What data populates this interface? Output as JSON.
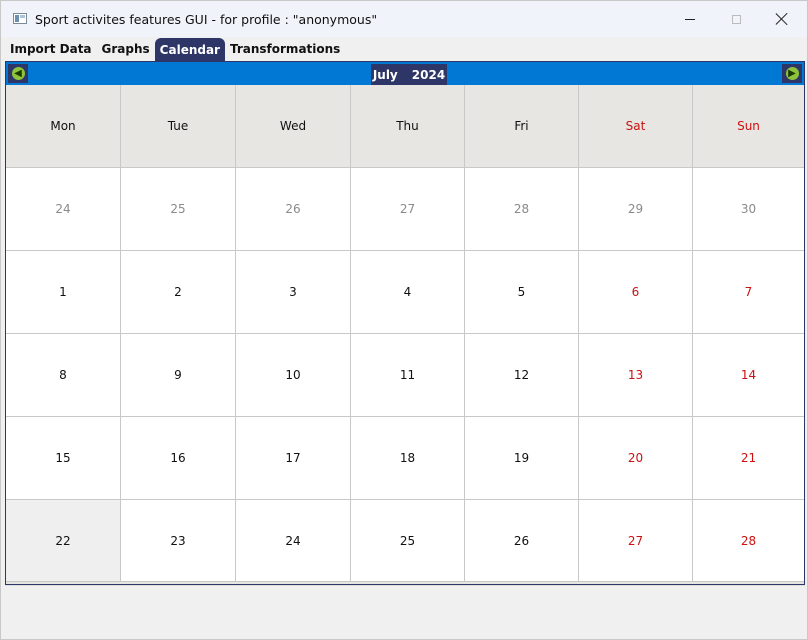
{
  "window": {
    "title": "Sport activites features GUI - for profile : \"anonymous\""
  },
  "tabs": [
    {
      "label": "Import Data"
    },
    {
      "label": "Graphs"
    },
    {
      "label": "Calendar"
    },
    {
      "label": "Transformations"
    }
  ],
  "calendar": {
    "month": "July",
    "year": "2024",
    "weekdays": [
      "Mon",
      "Tue",
      "Wed",
      "Thu",
      "Fri",
      "Sat",
      "Sun"
    ],
    "weeks": [
      [
        "24",
        "25",
        "26",
        "27",
        "28",
        "29",
        "30"
      ],
      [
        "1",
        "2",
        "3",
        "4",
        "5",
        "6",
        "7"
      ],
      [
        "8",
        "9",
        "10",
        "11",
        "12",
        "13",
        "14"
      ],
      [
        "15",
        "16",
        "17",
        "18",
        "19",
        "20",
        "21"
      ],
      [
        "22",
        "23",
        "24",
        "25",
        "26",
        "27",
        "28"
      ]
    ],
    "colors": {
      "weekend_text": "#cc1111",
      "other_month_text": "#8a8a8a",
      "nav_bar": "#0178d4",
      "accent": "#2e3668"
    }
  },
  "icons": {
    "prev": "arrow-left-icon",
    "next": "arrow-right-icon"
  }
}
